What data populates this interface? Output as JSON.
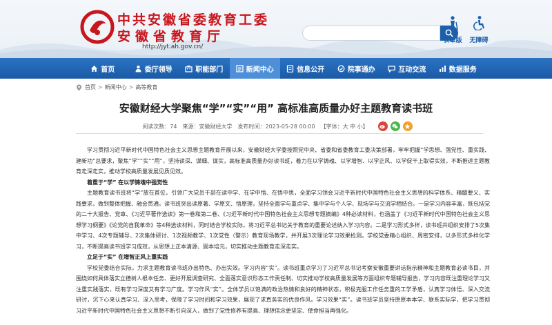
{
  "header": {
    "title_cn": "中共安徽省委教育工委",
    "subtitle_cn": "安徽省教育厅",
    "url": "http://jyt.ah.gov.cn/",
    "search_placeholder": "",
    "tools": [
      {
        "label": "长辈版",
        "icon": "elder-mode-icon"
      },
      {
        "label": "无障碍",
        "icon": "accessibility-icon"
      }
    ],
    "brand_color": "#c8161d",
    "accent_color": "#1d5fab"
  },
  "nav": {
    "items": [
      {
        "label": "首页",
        "icon": "home-icon"
      },
      {
        "label": "委厅领导",
        "icon": "leader-icon"
      },
      {
        "label": "职能部门",
        "icon": "department-icon"
      },
      {
        "label": "新闻中心",
        "icon": "news-icon",
        "active": true
      },
      {
        "label": "信息公开",
        "icon": "info-icon"
      },
      {
        "label": "院事通办",
        "icon": "service-icon"
      },
      {
        "label": "互动交流",
        "icon": "chat-icon"
      },
      {
        "label": "数据服务",
        "icon": "data-icon"
      }
    ]
  },
  "breadcrumb": {
    "items": [
      "首页",
      "新闻中心",
      "高等教育"
    ]
  },
  "article": {
    "title": "安徽财经大学聚焦“学”“实”“用” 高标准高质量办好主题教育读书班",
    "meta": {
      "views": "阅读次数：74",
      "source": "来源：安徽财经大学",
      "date": "发布时间：2023-05-28 00:00",
      "font": "【字体：大 中 小】"
    },
    "paragraphs": [
      "学习贯彻习近平新时代中国特色社会主义思想主题教育开展以来，安徽财经大学委按照党中央、省委和省委教育工委决策部署，牢牢把握“学思想、强党性、重实践、建新功”总要求，聚焦“学”“实”“用”，坚持读深、谋细、谋实，高标准高质量办好读书班，着力在以学铸魂、以学增智、以学正风、以学促干上取得实效，不断推进主题教育走深走实，推动学校高质量发展见质见效。",
      "着重于“学” 在以学铸魂中强觉性",
      "主题教育读书班将“学”放在首位，引领广大党员干部在读中学、在学中悟、在悟中思，全面学习领会习近平新时代中国特色社会主义思想的科学体系、精髓要义、实践要求，做到整体把握、融会贯通。读书班突出读原著、学原文、悟原理，坚持全面学与重点学、集中学与个人学、现场学与交流学相结合。一是学习内容丰富，既包括党的二十大报告、党章、《习近平著作选读》第一卷和第二卷、《习近平新时代中国特色社会主义思想专题摘编》4种必读材料，也涵盖了《习近平新时代中国特色社会主义思想学习纲要》《论党的自我革命》等4种选读材料，同时结合学校实际，将习近平总书记关于教育的重要论述纳入学习内容。二是学习形式多样，读书班共组织安排了5次集中学习、4次专题辅导、2次集体研讨、1次视频教学、1次党性（警示）教育现场教学，并开展3次理论学习效果检测。学校党委精心组织、周密安排，以多形式多样化学习，不断提高读书班学习成效，从思想上正本清源、固本培元，切实推动主题教育走深走实。",
      "立足于“实” 在增智正风上重实践",
      "学校党委结合实际，力求主题教育读书班办出特色、办出实效。学习内容“实”。读书班重点学习了习近平总书记考察安徽重要讲话指示精神和主题教育必读书目，并围绕如何具体落实立德树人根本任务、更好开展调查研究、全面落实意识形态工作责任制、切实推动学校高质量发展等方面组织专题辅导报告，学习内容既注重理论学习又注重实践落实，既有学习深度又有学习广度。学习作风“实”。全体学员以饱满的政治热情和良好的精神状态，积极克服工作任务重的工学矛盾，认真学习体悟、深入交流研讨，沉下心来认真学习、深入思考，保障了学习时间和学习效果，展现了求真务实的优良作风。学习效果“实”。读书班学员坚持原原本本学、联系实际学，把学习贯彻习近平新时代中国特色社会主义思想不断引向深入，做到了党性修养有提高、理想信念更坚定、使命担当再强化。"
    ]
  }
}
